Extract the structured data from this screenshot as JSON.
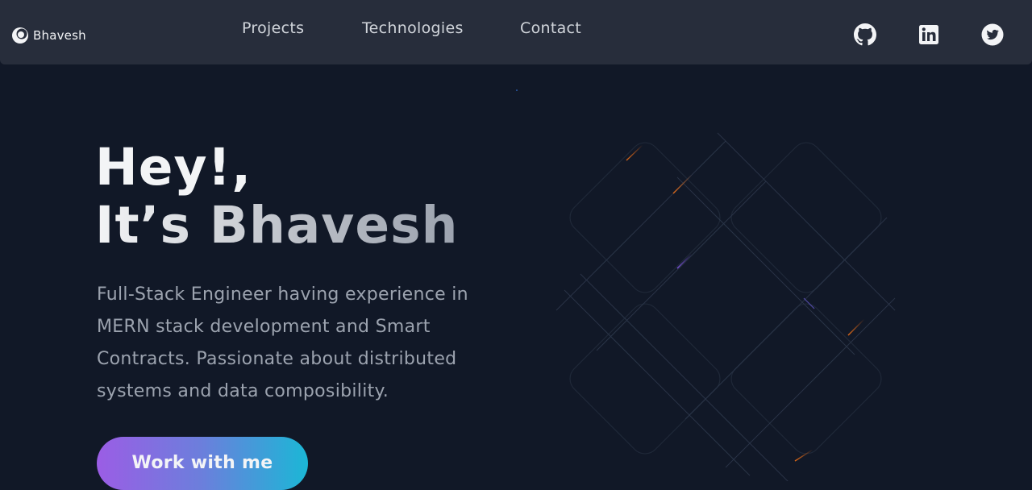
{
  "navbar": {
    "brand": {
      "name": "Bhavesh",
      "icon": "logo-icon"
    },
    "links": [
      {
        "label": "Projects"
      },
      {
        "label": "Technologies"
      },
      {
        "label": "Contact"
      }
    ],
    "social": [
      {
        "icon": "github-icon"
      },
      {
        "icon": "linkedin-icon"
      },
      {
        "icon": "twitter-icon"
      }
    ]
  },
  "hero": {
    "greeting": "Hey!,",
    "name_line": "It’s Bhavesh",
    "description": "Full-Stack Engineer having experience in MERN stack development and Smart Contracts. Passionate about distributed systems and data composibility.",
    "cta_label": "Work with me"
  },
  "colors": {
    "background": "#111827",
    "navbar": "#272d3b",
    "cta_gradient_start": "#9b5de5",
    "cta_gradient_end": "#1bb7d6"
  }
}
